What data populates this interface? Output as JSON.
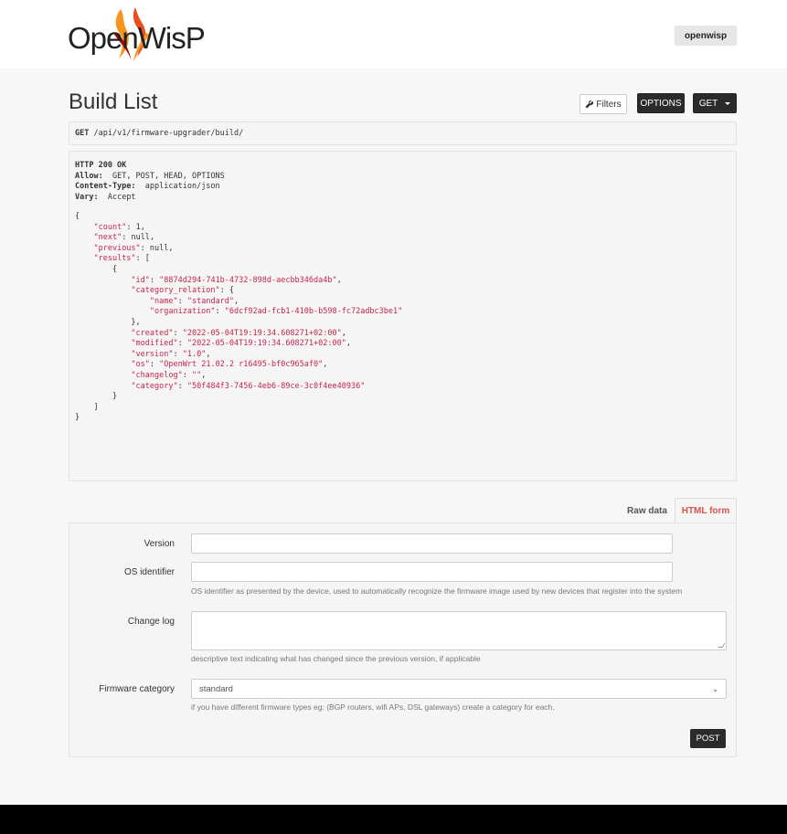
{
  "header": {
    "logo_text": "OpenWisP",
    "user": "openwisp"
  },
  "page": {
    "title": "Build List",
    "filters_label": "Filters",
    "options_label": "OPTIONS",
    "get_label": "GET"
  },
  "request": {
    "method": "GET",
    "path": "/api/v1/firmware-upgrader/build/"
  },
  "response": {
    "status": "HTTP 200 OK",
    "headers": [
      {
        "name": "Allow:",
        "value": "GET, POST, HEAD, OPTIONS"
      },
      {
        "name": "Content-Type:",
        "value": "application/json"
      },
      {
        "name": "Vary:",
        "value": "Accept"
      }
    ],
    "body": {
      "count": "1",
      "next": "null",
      "previous": "null",
      "id": "\"8874d294-741b-4732-898d-aecbb346da4b\"",
      "category_name": "\"standard\"",
      "category_organization": "\"6dcf92ad-fcb1-410b-b598-fc72adbc3be1\"",
      "created": "\"2022-05-04T19:19:34.608271+02:00\"",
      "modified": "\"2022-05-04T19:19:34.608271+02:00\"",
      "version": "\"1.0\"",
      "os": "\"OpenWrt 21.02.2 r16495-bf0c965af0\"",
      "changelog": "\"\"",
      "category": "\"50f484f3-7456-4eb6-89ce-3c0f4ee40936\""
    }
  },
  "tabs": {
    "raw": "Raw data",
    "html": "HTML form"
  },
  "form": {
    "version_label": "Version",
    "version_value": "",
    "os_label": "OS identifier",
    "os_value": "",
    "os_help": "OS identifier as presented by the device, used to automatically recognize the firmware image used by new devices that register into the system",
    "changelog_label": "Change log",
    "changelog_value": "",
    "changelog_help": "descriptive text indicating what has changed since the previous version, if applicable",
    "category_label": "Firmware category",
    "category_value": "standard",
    "category_help": "if you have different firmware types eg: (BGP routers, wifi APs, DSL gateways) create a category for each.",
    "post_label": "POST"
  },
  "colors": {
    "accent_tab": "#d9534f",
    "json_key": "#c7254e",
    "dark_button": "#2b2b2b"
  }
}
